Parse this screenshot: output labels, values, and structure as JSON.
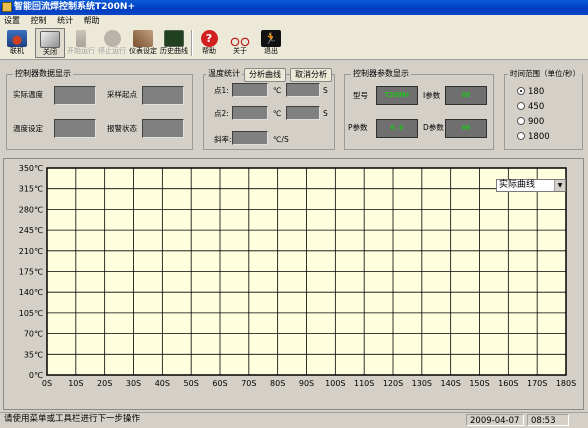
{
  "window": {
    "title": "智能回流焊控制系统T200N+"
  },
  "menu": [
    "设置",
    "控制",
    "统计",
    "帮助"
  ],
  "toolbar": [
    {
      "label": "联机",
      "icon": "connect-icon",
      "state": "normal"
    },
    {
      "label": "关闭",
      "icon": "close-connection-icon",
      "state": "active"
    },
    {
      "label": "开始运行",
      "icon": "start-run-icon",
      "state": "disabled"
    },
    {
      "label": "停止运行",
      "icon": "stop-icon",
      "state": "disabled"
    },
    {
      "label": "仪表设定",
      "icon": "meter-settings-icon",
      "state": "normal"
    },
    {
      "label": "历史曲线",
      "icon": "history-curve-icon",
      "state": "normal"
    },
    {
      "label": "帮助",
      "icon": "help-icon",
      "state": "normal"
    },
    {
      "label": "关于",
      "icon": "about-bike-icon",
      "state": "normal"
    },
    {
      "label": "退出",
      "icon": "exit-icon",
      "state": "normal"
    }
  ],
  "controller_data": {
    "title": "控制器数据显示",
    "actual_temp_label": "实际温度",
    "sampling_label": "采样起点",
    "set_temp_label": "温度设定",
    "alarm_label": "报警状态"
  },
  "temp_stats": {
    "title": "温度统计",
    "analyze_button": "分析曲线",
    "cancel_button": "取消分析",
    "point1_label": "点1:",
    "point2_label": "点2:",
    "slope_label": "斜率:",
    "unit_c": "℃",
    "unit_s": "S",
    "unit_rate": "℃/S"
  },
  "controller_params": {
    "title": "控制器参数显示",
    "model_label": "型号",
    "i_label": "I参数",
    "p_label": "P参数",
    "d_label": "D参数",
    "model_value": "T200N+",
    "i_value": "00",
    "p_value": "0.0",
    "d_value": "00"
  },
  "time_range": {
    "title": "时间范围（单位/秒）",
    "options": [
      "180",
      "450",
      "900",
      "1800"
    ],
    "selected": "180"
  },
  "chart_select": {
    "value": "实际曲线"
  },
  "chart_data": {
    "type": "line",
    "title": "",
    "xlabel": "",
    "ylabel": "",
    "xlim": [
      0,
      180
    ],
    "ylim": [
      0,
      350
    ],
    "x_ticks": [
      "0S",
      "10S",
      "20S",
      "30S",
      "40S",
      "50S",
      "60S",
      "70S",
      "80S",
      "90S",
      "100S",
      "110S",
      "120S",
      "130S",
      "140S",
      "150S",
      "160S",
      "170S",
      "180S"
    ],
    "y_ticks": [
      "0℃",
      "35℃",
      "70℃",
      "105℃",
      "140℃",
      "175℃",
      "210℃",
      "245℃",
      "280℃",
      "315℃",
      "350℃"
    ],
    "grid": true,
    "series": []
  },
  "status": {
    "message": "请使用菜单或工具栏进行下一步操作",
    "date": "2009-04-07",
    "time": "08:53"
  },
  "colors": {
    "plot_bg": "#ffffe0",
    "grid": "#000000",
    "title_bar": "#0a46c8",
    "digit": "#00e000"
  }
}
